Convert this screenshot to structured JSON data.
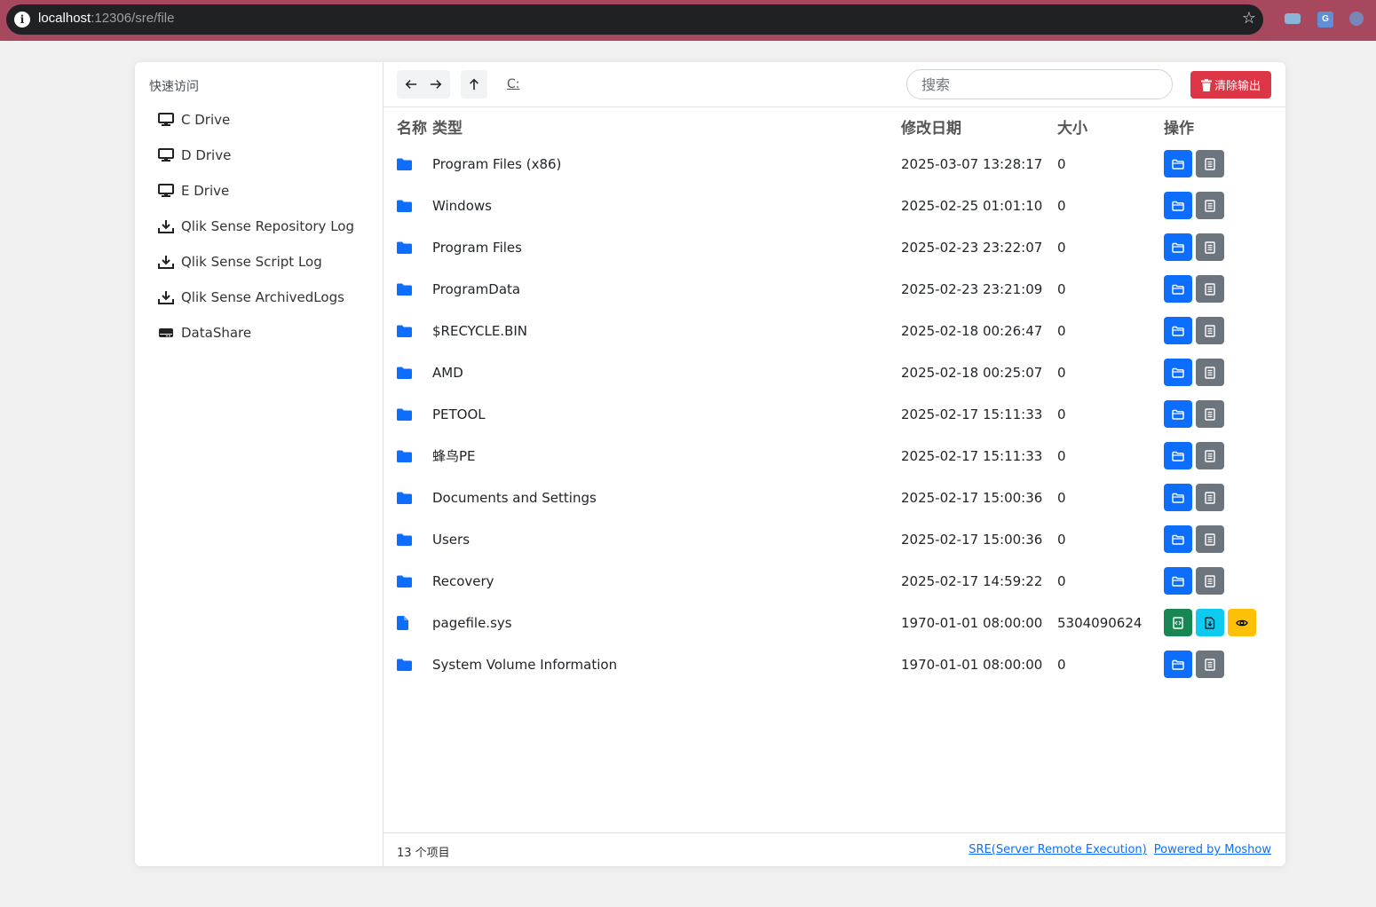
{
  "browser": {
    "url_host": "localhost",
    "url_rest": ":12306/sre/file"
  },
  "sidebar": {
    "title": "快速访问",
    "items": [
      {
        "label": "C Drive",
        "icon": "monitor-icon"
      },
      {
        "label": "D Drive",
        "icon": "monitor-icon"
      },
      {
        "label": "E Drive",
        "icon": "monitor-icon"
      },
      {
        "label": "Qlik Sense Repository Log",
        "icon": "download-icon"
      },
      {
        "label": "Qlik Sense Script Log",
        "icon": "download-icon"
      },
      {
        "label": "Qlik Sense ArchivedLogs",
        "icon": "download-icon"
      },
      {
        "label": "DataShare",
        "icon": "hard-drive-icon"
      }
    ]
  },
  "toolbar": {
    "breadcrumb": "C:",
    "search_placeholder": "搜索",
    "clear_label": "清除输出"
  },
  "table": {
    "headers": {
      "name": "名称",
      "type": "类型",
      "date": "修改日期",
      "size": "大小",
      "ops": "操作"
    },
    "rows": [
      {
        "name": "Program Files (x86)",
        "date": "2025-03-07 13:28:17",
        "size": "0",
        "kind": "folder"
      },
      {
        "name": "Windows",
        "date": "2025-02-25 01:01:10",
        "size": "0",
        "kind": "folder"
      },
      {
        "name": "Program Files",
        "date": "2025-02-23 23:22:07",
        "size": "0",
        "kind": "folder"
      },
      {
        "name": "ProgramData",
        "date": "2025-02-23 23:21:09",
        "size": "0",
        "kind": "folder"
      },
      {
        "name": "$RECYCLE.BIN",
        "date": "2025-02-18 00:26:47",
        "size": "0",
        "kind": "folder"
      },
      {
        "name": "AMD",
        "date": "2025-02-18 00:25:07",
        "size": "0",
        "kind": "folder"
      },
      {
        "name": "PETOOL",
        "date": "2025-02-17 15:11:33",
        "size": "0",
        "kind": "folder"
      },
      {
        "name": "蜂鸟PE",
        "date": "2025-02-17 15:11:33",
        "size": "0",
        "kind": "folder"
      },
      {
        "name": "Documents and Settings",
        "date": "2025-02-17 15:00:36",
        "size": "0",
        "kind": "folder"
      },
      {
        "name": "Users",
        "date": "2025-02-17 15:00:36",
        "size": "0",
        "kind": "folder"
      },
      {
        "name": "Recovery",
        "date": "2025-02-17 14:59:22",
        "size": "0",
        "kind": "folder"
      },
      {
        "name": "pagefile.sys",
        "date": "1970-01-01 08:00:00",
        "size": "5304090624",
        "kind": "file"
      },
      {
        "name": "System Volume Information",
        "date": "1970-01-01 08:00:00",
        "size": "0",
        "kind": "folder"
      }
    ]
  },
  "footer": {
    "count": "13 个项目",
    "link1": "SRE(Server Remote Execution)",
    "link2": "Powered by Moshow"
  },
  "colors": {
    "primary": "#0d6efd",
    "secondary": "#6c757d",
    "success": "#198754",
    "info": "#0dcaf0",
    "warning": "#ffc107",
    "danger": "#dc3545"
  }
}
